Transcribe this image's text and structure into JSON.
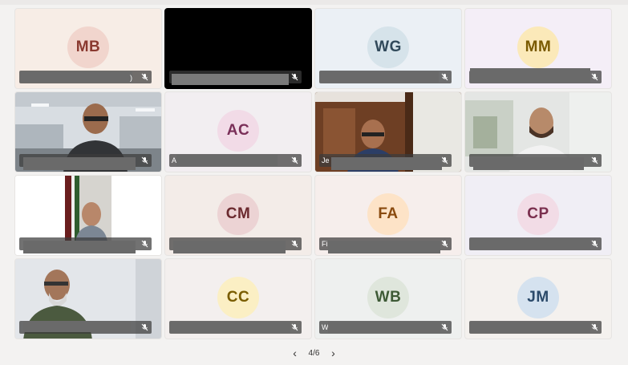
{
  "tiles": [
    {
      "initials": "MB",
      "bg": "#f7ede6",
      "circle": "#f1d5cd",
      "color": "#8a3a30",
      "name_fragment": ")"
    },
    {
      "initials": "",
      "bg": "#000000",
      "circle": "",
      "color": "",
      "name_fragment": ""
    },
    {
      "initials": "WG",
      "bg": "#ebf0f5",
      "circle": "#d6e3ea",
      "color": "#31495a",
      "name_fragment": ""
    },
    {
      "initials": "MM",
      "bg": "#f4eef7",
      "circle": "#fbe9b9",
      "color": "#7a5a00",
      "name_fragment": ""
    },
    {
      "initials": "",
      "bg": "#cfd6dd",
      "circle": "",
      "color": "",
      "name_fragment": ""
    },
    {
      "initials": "AC",
      "bg": "#f2eef1",
      "circle": "#f2dbe7",
      "color": "#7a2f58",
      "name_fragment": "A"
    },
    {
      "initials": "",
      "bg": "#7d4a2c",
      "circle": "",
      "color": "",
      "name_fragment": "Je"
    },
    {
      "initials": "",
      "bg": "#d9dcdc",
      "circle": "",
      "color": "",
      "name_fragment": ""
    },
    {
      "initials": "",
      "bg": "#ffffff",
      "circle": "",
      "color": "",
      "name_fragment": ""
    },
    {
      "initials": "CM",
      "bg": "#f3ece8",
      "circle": "#ecd3d4",
      "color": "#6b2a2f",
      "name_fragment": ""
    },
    {
      "initials": "FA",
      "bg": "#f6eeec",
      "circle": "#fde3c7",
      "color": "#8a4b0f",
      "name_fragment": "Fi"
    },
    {
      "initials": "CP",
      "bg": "#f0eef5",
      "circle": "#f2dce6",
      "color": "#7a2f4e",
      "name_fragment": ""
    },
    {
      "initials": "",
      "bg": "#dfe3e8",
      "circle": "",
      "color": "",
      "name_fragment": ""
    },
    {
      "initials": "CC",
      "bg": "#f3efee",
      "circle": "#fbefc4",
      "color": "#7a5d00",
      "name_fragment": ""
    },
    {
      "initials": "WB",
      "bg": "#eef0ef",
      "circle": "#dfe6dc",
      "color": "#3e5a36",
      "name_fragment": "W"
    },
    {
      "initials": "JM",
      "bg": "#f4f1ee",
      "circle": "#d5e2ef",
      "color": "#2b4a6a",
      "name_fragment": ""
    }
  ],
  "pagination": {
    "prev": "‹",
    "label": "4/6",
    "next": "›"
  }
}
